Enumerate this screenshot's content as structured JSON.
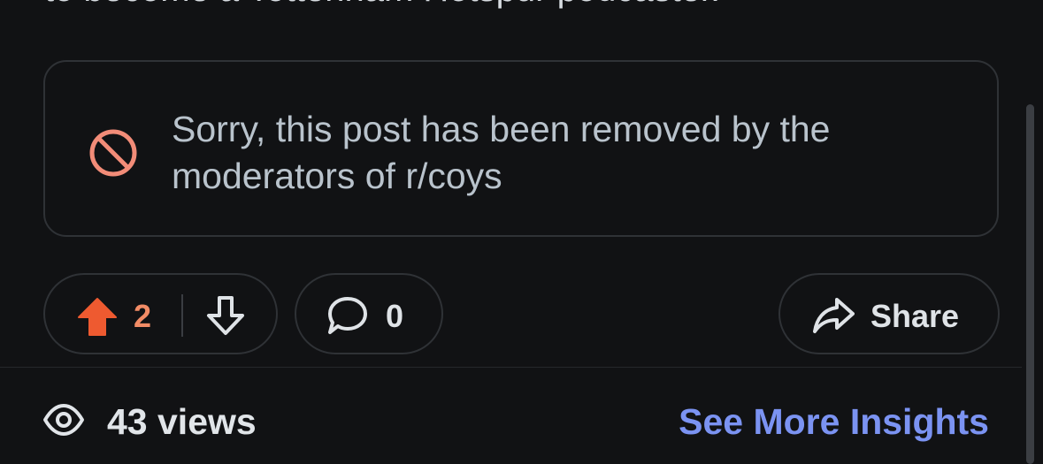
{
  "post": {
    "text_fragment": "to become a Tottenham Hotspur podcaster.",
    "removed_notice": "Sorry, this post has been removed by the moderators of r/coys"
  },
  "actions": {
    "score": "2",
    "comment_count": "0",
    "share_label": "Share"
  },
  "footer": {
    "views": "43 views",
    "insights_link": "See More Insights"
  },
  "icons": {
    "removed": "prohibited-icon",
    "upvote": "arrow-up-filled-icon",
    "downvote": "arrow-down-outline-icon",
    "comment": "speech-bubble-icon",
    "share": "share-arrow-icon",
    "views": "eye-icon"
  },
  "colors": {
    "background": "#111214",
    "upvote_accent": "#ee5a30",
    "removed_icon": "#f28c78",
    "link": "#7b93f2"
  }
}
